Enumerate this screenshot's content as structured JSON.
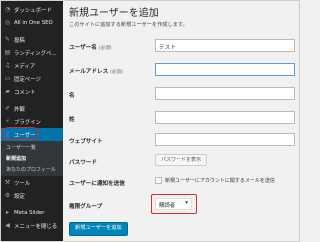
{
  "sidebar": {
    "items": [
      {
        "icon": "gauge-icon",
        "label": "ダッシュボード"
      },
      {
        "icon": "seo-icon",
        "label": "All in One SEO"
      },
      {
        "icon": "pin-icon",
        "label": "投稿"
      },
      {
        "icon": "landing-icon",
        "label": "ランディングペ..."
      },
      {
        "icon": "media-icon",
        "label": "メディア"
      },
      {
        "icon": "page-icon",
        "label": "固定ページ"
      },
      {
        "icon": "comment-icon",
        "label": "コメント"
      },
      {
        "icon": "brush-icon",
        "label": "外観"
      },
      {
        "icon": "plugin-icon",
        "label": "プラグイン"
      },
      {
        "icon": "user-icon",
        "label": "ユーザー"
      }
    ],
    "submenu": [
      "ユーザー一覧",
      "新規追加",
      "あなたのプロフィール"
    ],
    "lower": [
      {
        "icon": "wrench-icon",
        "label": "ツール"
      },
      {
        "icon": "settings-icon",
        "label": "設定"
      },
      {
        "icon": "slider-icon",
        "label": "Meta Slider"
      },
      {
        "icon": "collapse-icon",
        "label": "メニューを閉じる"
      }
    ]
  },
  "main": {
    "title": "新規ユーザーを追加",
    "description": "このサイトに追加する新規ユーザーを作成します。",
    "fields": {
      "username_label": "ユーザー名",
      "username_req": "(必須)",
      "username_value": "テスト",
      "email_label": "メールアドレス",
      "email_req": "(必須)",
      "email_value": "",
      "firstname_label": "名",
      "lastname_label": "姓",
      "website_label": "ウェブサイト",
      "password_label": "パスワード",
      "password_button": "パスワードを表示",
      "notify_label": "ユーザーに通知を送信",
      "notify_text": "新規ユーザーにアカウントに関するメールを送信",
      "role_label": "権限グループ",
      "role_value": "購読者"
    },
    "submit_label": "新規ユーザーを追加"
  }
}
